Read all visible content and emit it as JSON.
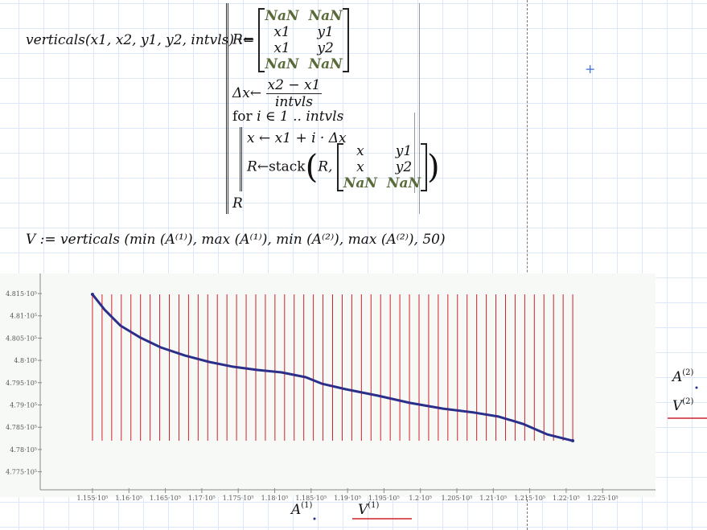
{
  "function_def": {
    "name": "verticals",
    "params": "(x1, x2, y1, y2, intvls)",
    "assign": ":=",
    "R": "R",
    "arrow": "←",
    "nan": "NaN",
    "matrix_init": [
      [
        "NaN",
        "NaN"
      ],
      [
        "x1",
        "y1"
      ],
      [
        "x1",
        "y2"
      ],
      [
        "NaN",
        "NaN"
      ]
    ],
    "dx": "Δx",
    "dx_num": "x2 − x1",
    "dx_den": "intvls",
    "for_kw": "for",
    "for_var": "i",
    "for_in": "∈",
    "for_range": "1 .. intvls",
    "x_assign": "x ← x1 + i · Δx",
    "stack_fn": "stack",
    "stack_first": "R,",
    "matrix_stack": [
      [
        "x",
        "y1"
      ],
      [
        "x",
        "y2"
      ],
      [
        "NaN",
        "NaN"
      ]
    ],
    "return": "R"
  },
  "v_def": {
    "text": "V := verticals (min (A⁽¹⁾), max (A⁽¹⁾), min (A⁽²⁾), max (A⁽²⁾), 50)"
  },
  "chart_data": {
    "type": "line",
    "xlim": [
      114783,
      123226
    ],
    "ylim": [
      477096,
      481771
    ],
    "x_ticks": [
      115500,
      116000,
      116500,
      117000,
      117500,
      118000,
      118500,
      119000,
      119500,
      120000,
      120500,
      121000,
      121500,
      122000,
      122500
    ],
    "x_tick_labels": [
      "1.155·10⁵",
      "1.16·10⁵",
      "1.165·10⁵",
      "1.17·10⁵",
      "1.175·10⁵",
      "1.18·10⁵",
      "1.185·10⁵",
      "1.19·10⁵",
      "1.195·10⁵",
      "1.2·10⁵",
      "1.205·10⁵",
      "1.21·10⁵",
      "1.215·10⁵",
      "1.22·10⁵",
      "1.225·10⁵"
    ],
    "y_ticks": [
      481500,
      481000,
      480500,
      480000,
      479500,
      479000,
      478500,
      478000,
      477500
    ],
    "y_tick_labels": [
      "4.815·10⁵",
      "4.81·10⁵",
      "4.805·10⁵",
      "4.8·10⁵",
      "4.795·10⁵",
      "4.79·10⁵",
      "4.785·10⁵",
      "4.78·10⁵",
      "4.775·10⁵"
    ],
    "x_legend": [
      {
        "label": "A",
        "sup": "(1)"
      },
      {
        "label": "V",
        "sup": "(1)"
      }
    ],
    "y_legend": [
      {
        "label": "A",
        "sup": "(2)"
      },
      {
        "label": "V",
        "sup": "(2)"
      }
    ],
    "series": [
      {
        "name": "A",
        "color": "#2b2f8a",
        "x": [
          115500,
          115666,
          115886,
          116162,
          116438,
          116769,
          117100,
          117432,
          117763,
          118094,
          118425,
          118646,
          118977,
          119418,
          119860,
          120302,
          120743,
          121075,
          121406,
          121737,
          122090
        ],
        "y": [
          481482,
          481139,
          480778,
          480507,
          480291,
          480110,
          479966,
          479857,
          479785,
          479731,
          479623,
          479478,
          479352,
          479208,
          479045,
          478919,
          478828,
          478738,
          478576,
          478341,
          478196
        ]
      },
      {
        "name": "V",
        "color": "#d0202a",
        "type": "verticals",
        "x_start": 115500,
        "x_end": 122090,
        "intervals": 50,
        "y_low": 478196,
        "y_high": 481482
      }
    ]
  }
}
